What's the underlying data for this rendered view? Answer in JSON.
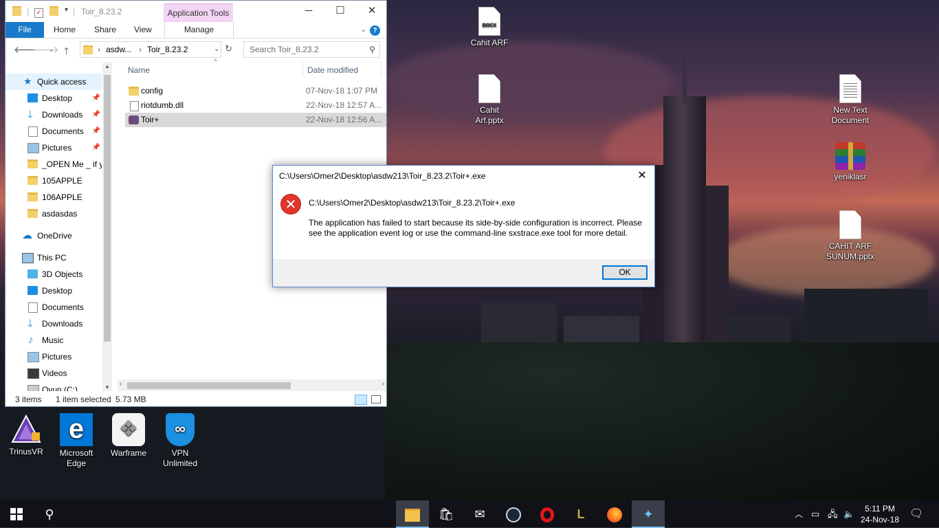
{
  "desktop": {
    "icons": {
      "cahit_docx": {
        "label": "Cahit ARF",
        "tag": "DOCX"
      },
      "cahit_pptx": {
        "label1": "Cahit",
        "label2": "Arf.pptx"
      },
      "new_text": {
        "label1": "New Text",
        "label2": "Document"
      },
      "yeniklasr": {
        "label": "yeniklasr"
      },
      "cahit_sunum": {
        "label1": "CAHIT ARF",
        "label2": "SUNUM.pptx"
      },
      "trinusvr": {
        "label": "TrinusVR"
      },
      "edge": {
        "label1": "Microsoft",
        "label2": "Edge"
      },
      "warframe": {
        "label": "Warframe"
      },
      "vpn": {
        "label1": "VPN",
        "label2": "Unlimited"
      }
    }
  },
  "explorer": {
    "title": "Toir_8.23.2",
    "app_tools": "Application Tools",
    "ribbon_tabs": {
      "file": "File",
      "home": "Home",
      "share": "Share",
      "view": "View",
      "manage": "Manage"
    },
    "breadcrumb": {
      "part1": "asdw...",
      "part2": "Toir_8.23.2"
    },
    "search_placeholder": "Search Toir_8.23.2",
    "nav": {
      "quick_access": "Quick access",
      "desktop": "Desktop",
      "downloads": "Downloads",
      "documents": "Documents",
      "pictures": "Pictures",
      "open_me": "_OPEN Me _ if yo",
      "apple105": "105APPLE",
      "apple106": "106APPLE",
      "asdasdas": "asdasdas",
      "onedrive": "OneDrive",
      "this_pc": "This PC",
      "objects3d": "3D Objects",
      "pc_desktop": "Desktop",
      "pc_documents": "Documents",
      "pc_downloads": "Downloads",
      "music": "Music",
      "pc_pictures": "Pictures",
      "videos": "Videos",
      "drive_c": "Oyun (C:)"
    },
    "columns": {
      "name": "Name",
      "date": "Date modified"
    },
    "files": [
      {
        "name": "config",
        "date": "07-Nov-18 1:07 PM"
      },
      {
        "name": "riotdumb.dll",
        "date": "22-Nov-18 12:57 A..."
      },
      {
        "name": "Toir+",
        "date": "22-Nov-18 12:56 A..."
      }
    ],
    "status": {
      "items": "3 items",
      "selected": "1 item selected",
      "size": "5.73 MB"
    }
  },
  "dialog": {
    "title": "C:\\Users\\Omer2\\Desktop\\asdw213\\Toir_8.23.2\\Toir+.exe",
    "path": "C:\\Users\\Omer2\\Desktop\\asdw213\\Toir_8.23.2\\Toir+.exe",
    "message": "The application has failed to start because its side-by-side configuration is incorrect. Please see the application event log or use the command-line sxstrace.exe tool for more detail.",
    "ok": "OK"
  },
  "taskbar": {
    "time": "5:11 PM",
    "date": "24-Nov-18"
  },
  "colors": {
    "accent": "#1979ca",
    "error": "#e0362c",
    "app_tools": "#f2d4f4"
  }
}
